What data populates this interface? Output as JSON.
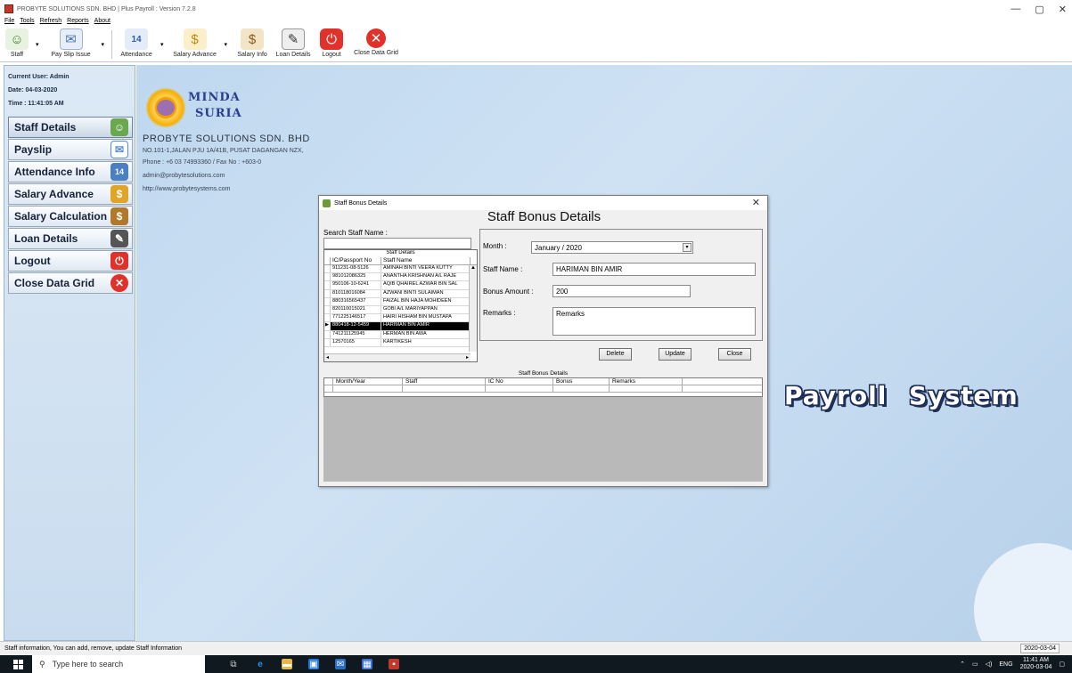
{
  "window": {
    "title": "PROBYTE SOLUTIONS  SDN. BHD | Plus Payroll : Version 7.2.8",
    "controls": [
      "—",
      "▢",
      "✕"
    ]
  },
  "menu": [
    "File",
    "Tools",
    "Refresh",
    "Reports",
    "About"
  ],
  "toolbar": [
    {
      "label": "Staff",
      "icon": "staff-icon",
      "dropdown": true
    },
    {
      "label": "Pay Slip Issue",
      "icon": "payslip-icon",
      "dropdown": true
    },
    {
      "label": "Attendance",
      "icon": "calendar-icon",
      "dropdown": true
    },
    {
      "label": "Salary Advance",
      "icon": "money-hand-icon",
      "dropdown": true
    },
    {
      "label": "Salary Info",
      "icon": "money-bag-icon",
      "dropdown": false
    },
    {
      "label": "Loan Details",
      "icon": "loan-icon",
      "dropdown": false
    },
    {
      "label": "Logout",
      "icon": "power-icon",
      "dropdown": false
    },
    {
      "label": "Close Data Grid",
      "icon": "close-icon",
      "dropdown": false
    }
  ],
  "user": {
    "current_user": "Current User: Admin",
    "date": "Date: 04-03-2020",
    "time": "Time : 11:41:05 AM"
  },
  "sidebar": [
    {
      "label": "Staff Details",
      "icon": "staff-icon",
      "color": "#6aa84f"
    },
    {
      "label": "Payslip",
      "icon": "payslip-icon",
      "color": "#5a8fd6"
    },
    {
      "label": "Attendance Info",
      "icon": "calendar-icon",
      "color": "#4a7fc1"
    },
    {
      "label": "Salary Advance",
      "icon": "money-hand-icon",
      "color": "#e0a526"
    },
    {
      "label": "Salary Calculation",
      "icon": "money-bag-icon",
      "color": "#b07a2a"
    },
    {
      "label": "Loan Details",
      "icon": "loan-icon",
      "color": "#555555"
    },
    {
      "label": "Logout",
      "icon": "power-icon",
      "color": "#e0312b"
    },
    {
      "label": "Close Data Grid",
      "icon": "close-icon",
      "color": "#e0312b"
    }
  ],
  "company": {
    "brand_line1": "MINDA",
    "brand_line2": "SURIA",
    "name": "PROBYTE SOLUTIONS  SDN. BHD",
    "address": "NO.101-1,JALAN PJU 1A/41B, PUSAT DAGANGAN NZX,",
    "phone": "Phone : +6 03 74993360 / Fax No : +603-0",
    "email": "admin@probytesolutions.com",
    "web": "http://www.probytesystems.com"
  },
  "banner": "Payroll System",
  "dialog": {
    "title": "Staff Bonus Details",
    "heading": "Staff Bonus Details",
    "search_label": "Search Staff Name :",
    "search_value": "",
    "staff_grid": {
      "caption": "Staff Details",
      "columns": [
        "IC/Passport No",
        "Staff Name"
      ],
      "rows": [
        [
          "911231-08-5126",
          "AMINAH BINTI VEERA KUTTY"
        ],
        [
          "981012086325",
          "ANANTHA KRISHNAN A/L RAJE"
        ],
        [
          "950106-10-6241",
          "AQIB QHAIREL AZWAR BIN SAL"
        ],
        [
          "810118016084",
          "AZWANI BINTI SULAIMAN"
        ],
        [
          "880316565437",
          "FAIZAL BIN HAJA MOHIDEEN"
        ],
        [
          "820110015021",
          "GOBI A/L MARIYAPPAN"
        ],
        [
          "771225146517",
          "HAIRI HISHAM BIN MUSTAPA"
        ],
        [
          "880418-12-5459",
          "HARIMAN BIN AMIR"
        ],
        [
          "741211125945",
          "HERMAN BIN AWA"
        ],
        [
          "12570165",
          "KARTIKESH"
        ]
      ],
      "selected_index": 7
    },
    "month_label": "Month :",
    "month_value": "January / 2020",
    "staff_name_label": "Staff Name :",
    "staff_name_value": "HARIMAN BIN AMIR",
    "bonus_label": "Bonus Amount :",
    "bonus_value": "200",
    "remarks_label": "Remarks :",
    "remarks_value": "Remarks",
    "buttons": {
      "delete": "Delete",
      "update": "Update",
      "close": "Close"
    },
    "bonus_grid": {
      "caption": "Staff Bonus Details",
      "columns": [
        "Month/Year",
        "Staff",
        "IC No",
        "Bonus",
        "Remarks"
      ]
    }
  },
  "status": {
    "text": "Staff information, You can add, remove, update Staff Information",
    "date": "2020-03-04"
  },
  "taskbar": {
    "search_placeholder": "Type here to search",
    "lang": "ENG",
    "time": "11:41 AM",
    "date": "2020-03-04"
  }
}
